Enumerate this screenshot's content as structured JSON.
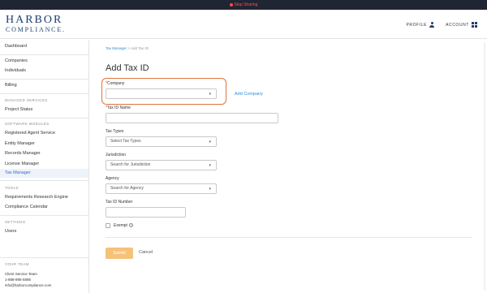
{
  "topbar": {
    "stop_label": "Stop Sharing"
  },
  "header": {
    "logo_line1": "HARBOR",
    "logo_line2": "COMPLIANCE.",
    "profile_label": "PROFILE",
    "account_label": "ACCOUNT"
  },
  "sidebar": {
    "dashboard": "Dashboard",
    "companies": "Companies",
    "individuals": "Individuals",
    "billing": "Billing",
    "managed_head": "MANAGED SERVICES",
    "project_status": "Project Status",
    "software_head": "SOFTWARE MODULES",
    "registered_agent": "Registered Agent Service",
    "entity_manager": "Entity Manager",
    "records_manager": "Records Manager",
    "license_manager": "License Manager",
    "tax_manager": "Tax Manager",
    "tools_head": "TOOLS",
    "requirements": "Requirements Research Engine",
    "compliance_calendar": "Compliance Calendar",
    "settings_head": "SETTINGS",
    "users": "Users",
    "team_head": "YOUR TEAM",
    "team_name": "Client Service Team",
    "team_phone": "1-888-995-5895",
    "team_email": "info@harborcompliance.com"
  },
  "main": {
    "breadcrumb_link": "Tax Manager",
    "breadcrumb_sep": ">",
    "breadcrumb_current": "Add Tax ID",
    "title": "Add Tax ID",
    "company_label": "Company",
    "add_company": "Add Company",
    "tax_id_name_label": "Tax ID Name",
    "tax_types_label": "Tax Types",
    "tax_types_placeholder": "Select Tax Types",
    "jurisdiction_label": "Jurisdiction",
    "jurisdiction_placeholder": "Search for Jurisdiction",
    "agency_label": "Agency",
    "agency_placeholder": "Search for Agency",
    "tax_id_number_label": "Tax ID Number",
    "exempt_label": "Exempt",
    "submit": "Submit",
    "cancel": "Cancel"
  },
  "colors": {
    "accent": "#2f8fd8",
    "highlight": "#e0733c",
    "submit_bg": "#f5c27a",
    "brand": "#1f3e6e"
  }
}
